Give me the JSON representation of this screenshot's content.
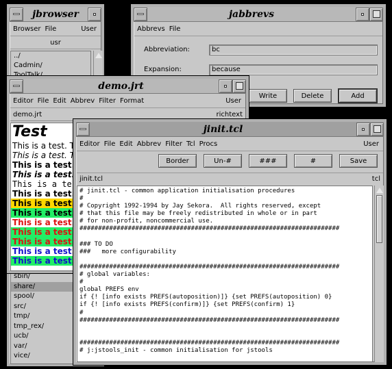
{
  "jbrowser": {
    "title": "jbrowser",
    "menus": [
      "Browser",
      "File"
    ],
    "menu_right": "User",
    "directory": "usr",
    "items_top": [
      "../",
      "Cadmin/",
      "ToolTalk/"
    ],
    "items_bottom": [
      "sbin/",
      "share/",
      "spool/",
      "src/",
      "tmp/",
      "tmp_rex/",
      "ucb/",
      "var/",
      "vice/"
    ],
    "selected": "share/"
  },
  "jabbrevs": {
    "title": "jabbrevs",
    "menus": [
      "Abbrevs",
      "File"
    ],
    "abbreviation_label": "Abbreviation:",
    "abbreviation_value": "bc",
    "expansion_label": "Expansion:",
    "expansion_value": "because",
    "write_label": "Write",
    "delete_label": "Delete",
    "add_label": "Add"
  },
  "demo": {
    "title": "demo.jrt",
    "menus": [
      "Editor",
      "File",
      "Edit",
      "Abbrev",
      "Filter",
      "Format"
    ],
    "menu_right": "User",
    "filename": "demo.jrt",
    "mode": "richtext",
    "heading": "Test",
    "lines": [
      {
        "text": "This is a test.  T",
        "style": "plain",
        "bg": "#ffffff",
        "fg": "#000000"
      },
      {
        "text": "This is a test.  T",
        "style": "italic",
        "bg": "#ffffff",
        "fg": "#000000"
      },
      {
        "text": "This is a test.",
        "style": "bold",
        "bg": "#ffffff",
        "fg": "#000000"
      },
      {
        "text": "This is a test.",
        "style": "bolditalic",
        "bg": "#ffffff",
        "fg": "#000000"
      },
      {
        "text": "This is a tes",
        "style": "mono",
        "bg": "#ffffff",
        "fg": "#000000"
      },
      {
        "text": "This is a test.",
        "style": "bold",
        "bg": "#ffffff",
        "fg": "#000000"
      },
      {
        "text": "This is a test.",
        "style": "bold",
        "bg": "#ffd700",
        "fg": "#000000"
      },
      {
        "text": "This is a test.",
        "style": "bold",
        "bg": "#22ee66",
        "fg": "#000000"
      },
      {
        "text": "This is a test.",
        "style": "bold",
        "bg": "#ffffff",
        "fg": "#dd1111"
      },
      {
        "text": "This is a test.",
        "style": "bold",
        "bg": "#22ee66",
        "fg": "#dd1111"
      },
      {
        "text": "This is a test.",
        "style": "bold",
        "bg": "#22ee66",
        "fg": "#dd1111"
      },
      {
        "text": "This is a test.",
        "style": "bold",
        "bg": "#ffffff",
        "fg": "#1111cc"
      },
      {
        "text": "This is a test.",
        "style": "bold",
        "bg": "#22ee66",
        "fg": "#1111cc"
      }
    ]
  },
  "jinit": {
    "title": "jinit.tcl",
    "menus": [
      "Editor",
      "File",
      "Edit",
      "Abbrev",
      "Filter",
      "Tcl",
      "Procs"
    ],
    "menu_right": "User",
    "buttons": [
      "Border",
      "Un-#",
      "###",
      "#",
      "Save"
    ],
    "filename": "jinit.tcl",
    "mode": "tcl",
    "code": [
      "# jinit.tcl - common application initialisation procedures",
      "#",
      "# Copyright 1992-1994 by Jay Sekora.  All rights reserved, except",
      "# that this file may be freely redistributed in whole or in part",
      "# for non-profit, noncommercial use.",
      "######################################################################",
      "",
      "### TO DO",
      "###   more configurability",
      "",
      "######################################################################",
      "# global variables:",
      "#",
      "global PREFS env",
      "if {! [info exists PREFS(autoposition)]} {set PREFS(autoposition) 0}",
      "if {! [info exists PREFS(confirm)]} {set PREFS(confirm) 1}",
      "#",
      "######################################################################",
      "",
      "",
      "######################################################################",
      "# j:jstools_init - common initialisation for jstools"
    ]
  }
}
